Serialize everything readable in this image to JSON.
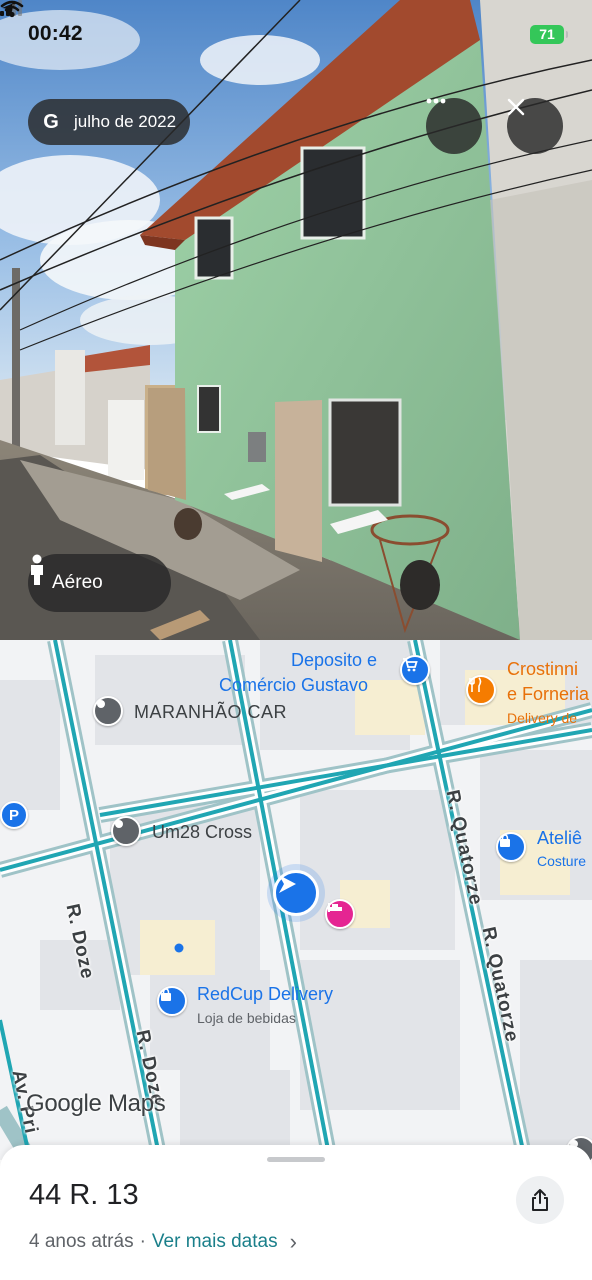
{
  "status_bar": {
    "time": "00:42",
    "battery": "71"
  },
  "streetview": {
    "date_label": "julho de 2022",
    "google_letter": "G",
    "aerial_label": "Aéreo",
    "icons": {
      "location": "location-arrow-icon",
      "more": "more-dots-icon",
      "close": "close-icon",
      "person": "pegman-icon"
    }
  },
  "map": {
    "places": [
      {
        "name": "Deposito e",
        "name2": "Comércio Gustavo",
        "icon": "shopping-cart-icon",
        "color": "#1a73e8"
      },
      {
        "name": "Crostinni",
        "name2": "e Forneria",
        "sub": "Delivery de",
        "icon": "restaurant-icon",
        "color": "#f57c00"
      },
      {
        "name": "MARANHÃO CAR",
        "icon": "place-pin-icon",
        "color": "#5f6368"
      },
      {
        "name": "Um28 Cross",
        "icon": "place-pin-icon",
        "color": "#5f6368"
      },
      {
        "name": "Ateliê",
        "sub": "Costure",
        "icon": "shopping-bag-icon",
        "color": "#1a73e8"
      },
      {
        "name": "RedCup Delivery",
        "sub": "Loja de bebidas",
        "icon": "shopping-bag-icon",
        "color": "#1a73e8"
      }
    ],
    "streets": [
      "R. Doze",
      "R. Doze",
      "R. Quatorze",
      "R. Quatorze",
      "Av. Pri"
    ],
    "parking_label": "P",
    "watermark": "Google Maps"
  },
  "sheet": {
    "address": "44 R. 13",
    "age": "4 anos atrás",
    "separator": "·",
    "more_dates": "Ver mais datas",
    "chevron": "›"
  }
}
